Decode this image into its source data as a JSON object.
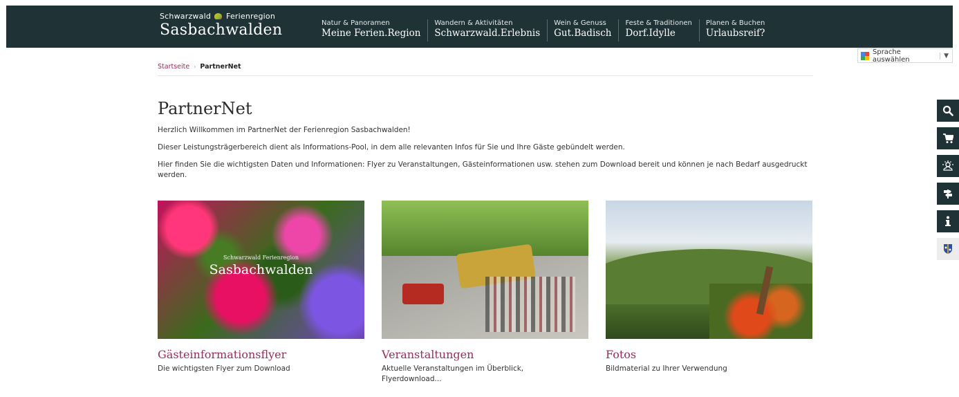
{
  "header": {
    "logo_small_left": "Schwarzwald",
    "logo_small_right": "Ferienregion",
    "logo_big": "Sasbachwalden",
    "nav": [
      {
        "sub": "Natur & Panoramen",
        "main": "Meine Ferien.Region"
      },
      {
        "sub": "Wandern & Aktivitäten",
        "main": "Schwarzwald.Erlebnis"
      },
      {
        "sub": "Wein & Genuss",
        "main": "Gut.Badisch"
      },
      {
        "sub": "Feste & Traditionen",
        "main": "Dorf.Idylle"
      },
      {
        "sub": "Planen & Buchen",
        "main": "Urlaubsreif?"
      }
    ]
  },
  "language": {
    "label": "Sprache auswählen",
    "arrow": "▼"
  },
  "breadcrumb": {
    "home": "Startseite",
    "sep": "›",
    "current": "PartnerNet"
  },
  "page": {
    "title": "PartnerNet",
    "intro": [
      "Herzlich Willkommen im PartnerNet der Ferienregion Sasbachwalden!",
      "Dieser Leistungsträgerbereich dient als Informations-Pool, in dem alle relevanten Infos für Sie und Ihre Gäste gebündelt werden.",
      "Hier finden Sie die wichtigsten Daten und Informationen: Flyer zu Veranstaltungen, Gästeinformationen usw. stehen zum Download bereit und können je nach Bedarf ausgedruckt werden."
    ]
  },
  "cards": [
    {
      "title": "Gästeinformationsflyer",
      "desc": "Die wichtigsten Flyer zum Download",
      "overlay_small": "Schwarzwald Ferienregion",
      "overlay_big": "Sasbachwalden"
    },
    {
      "title": "Veranstaltungen",
      "desc": "Aktuelle Veranstaltungen im Überblick, Flyerdownload..."
    },
    {
      "title": "Fotos",
      "desc": "Bildmaterial zu Ihrer Verwendung"
    }
  ],
  "sidebar_icons": [
    "search-icon",
    "cart-icon",
    "weather-icon",
    "signpost-icon",
    "info-icon",
    "coat-of-arms-icon"
  ],
  "colors": {
    "header_bg": "#1f3236",
    "accent": "#9c2a5c"
  }
}
